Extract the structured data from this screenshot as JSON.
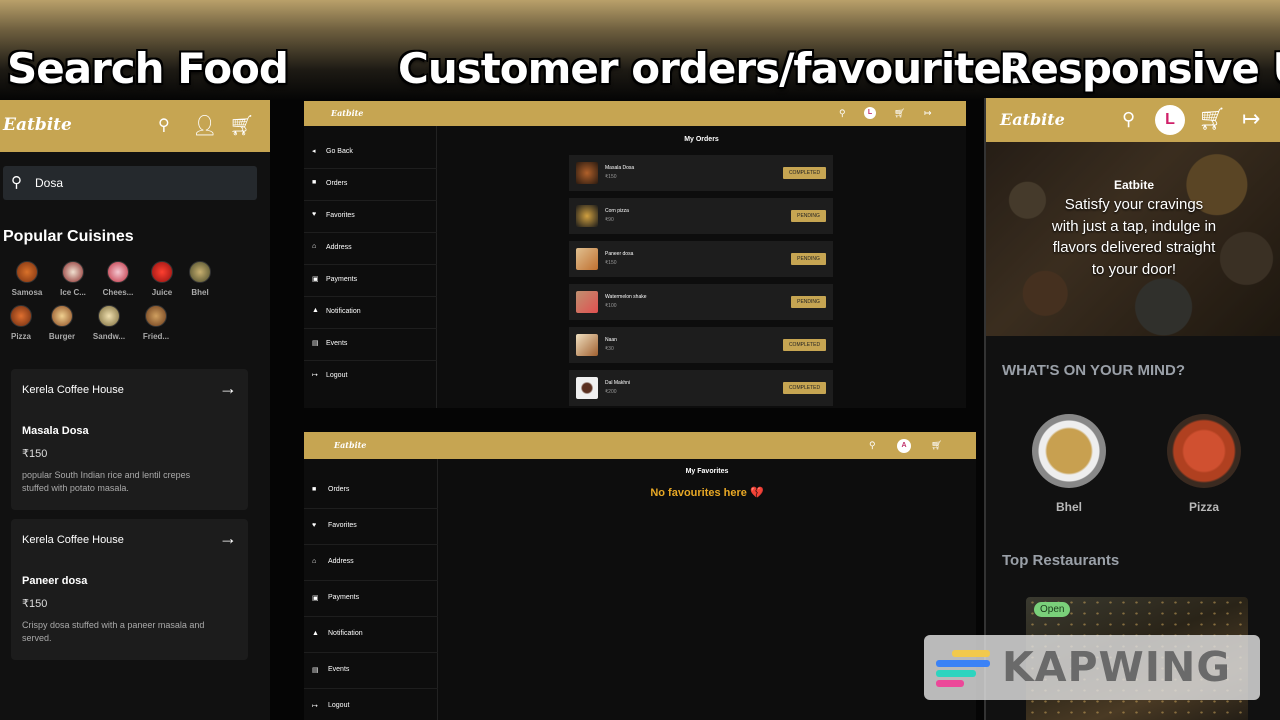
{
  "headings": {
    "search": "Search Food",
    "orders": "Customer orders/favourites",
    "responsive": "Responsive UI"
  },
  "brand": "Eatbite",
  "search_panel": {
    "search_value": "Dosa",
    "popular_title": "Popular Cuisines",
    "cuisines": [
      "Samosa",
      "Ice C...",
      "Chees...",
      "Juice",
      "Bhel",
      "Pizza",
      "Burger",
      "Sandw...",
      "Fried..."
    ],
    "dishes": [
      {
        "restaurant": "Kerela Coffee House",
        "name": "Masala Dosa",
        "price": "₹150",
        "desc": "popular South Indian rice and lentil crepes stuffed with potato masala."
      },
      {
        "restaurant": "Kerela Coffee House",
        "name": "Paneer dosa",
        "price": "₹150",
        "desc": "Crispy dosa stuffed with a paneer masala and served."
      }
    ]
  },
  "orders_panel": {
    "avatar": "L",
    "sidebar": [
      "Go Back",
      "Orders",
      "Favorites",
      "Address",
      "Payments",
      "Notification",
      "Events",
      "Logout"
    ],
    "title": "My Orders",
    "orders": [
      {
        "name": "Masala Dosa",
        "price": "₹150",
        "status": "COMPLETED"
      },
      {
        "name": "Corn pizza",
        "price": "₹90",
        "status": "PENDING"
      },
      {
        "name": "Paneer dosa",
        "price": "₹150",
        "status": "PENDING"
      },
      {
        "name": "Watermelon shake",
        "price": "₹100",
        "status": "PENDING"
      },
      {
        "name": "Naan",
        "price": "₹30",
        "status": "COMPLETED"
      },
      {
        "name": "Dal Makhni",
        "price": "₹200",
        "status": "COMPLETED"
      }
    ]
  },
  "favorites_panel": {
    "avatar": "A",
    "sidebar": [
      "Orders",
      "Favorites",
      "Address",
      "Payments",
      "Notification",
      "Events",
      "Logout"
    ],
    "title": "My Favorites",
    "empty": "No favourites here 💔"
  },
  "mobile_panel": {
    "avatar": "L",
    "hero_brand": "Eatbite",
    "hero_tagline": "Satisfy your cravings with just a tap, indulge in flavors delivered straight to your door!",
    "mind_title": "WHAT'S ON YOUR MIND?",
    "mind_items": [
      "Bhel",
      "Pizza"
    ],
    "top_title": "Top Restaurants",
    "open_badge": "Open"
  },
  "watermark": "KAPWING",
  "colors": {
    "accent": "#c6a552",
    "status_bg": "#c6a552",
    "empty_text": "#e8a825",
    "open": "#7ad07a"
  }
}
